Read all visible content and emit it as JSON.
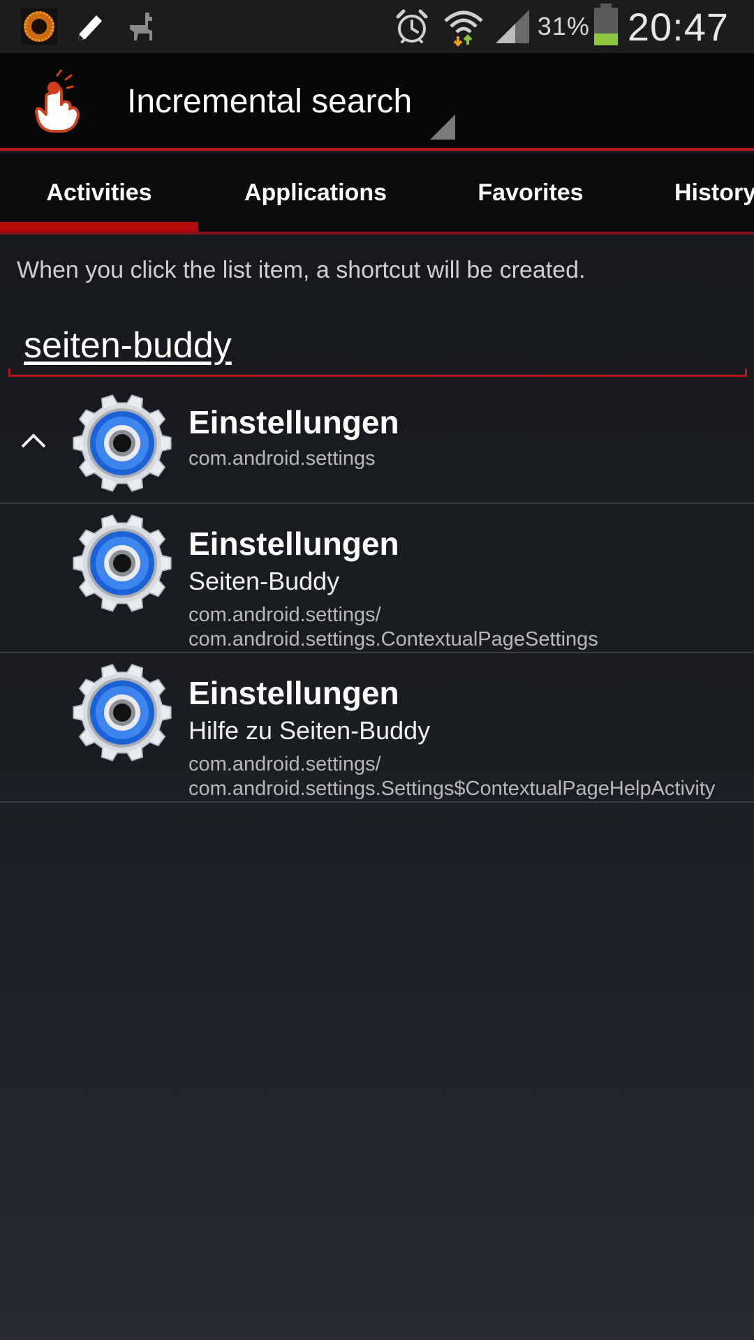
{
  "status_bar": {
    "icons_left": [
      "aperture-icon",
      "pencil-icon",
      "llama-icon"
    ],
    "icons_right": [
      "alarm-icon",
      "wifi-icon",
      "signal-icon"
    ],
    "battery_percent_label": "31%",
    "battery_level": 0.31,
    "time": "20:47"
  },
  "action_bar": {
    "title": "Incremental search",
    "icon": "touch-hand-icon"
  },
  "tabs": [
    {
      "label": "Activities",
      "active": true
    },
    {
      "label": "Applications",
      "active": false
    },
    {
      "label": "Favorites",
      "active": false
    },
    {
      "label": "History",
      "active": false
    }
  ],
  "hint": "When you click the list item, a shortcut will be created.",
  "search": {
    "value": "seiten-buddy"
  },
  "results": [
    {
      "title": "Einstellungen",
      "subtitle": "",
      "meta_line1": "com.android.settings",
      "meta_line2": ""
    },
    {
      "title": "Einstellungen",
      "subtitle": "Seiten-Buddy",
      "meta_line1": "com.android.settings/",
      "meta_line2": "com.android.settings.ContextualPageSettings"
    },
    {
      "title": "Einstellungen",
      "subtitle": "Hilfe zu Seiten-Buddy",
      "meta_line1": "com.android.settings/",
      "meta_line2": "com.android.settings.Settings$ContextualPageHelpActivity"
    }
  ],
  "colors": {
    "accent": "#b5181c",
    "battery": "#8cc63e",
    "settings_blue": "#1b62d6"
  }
}
